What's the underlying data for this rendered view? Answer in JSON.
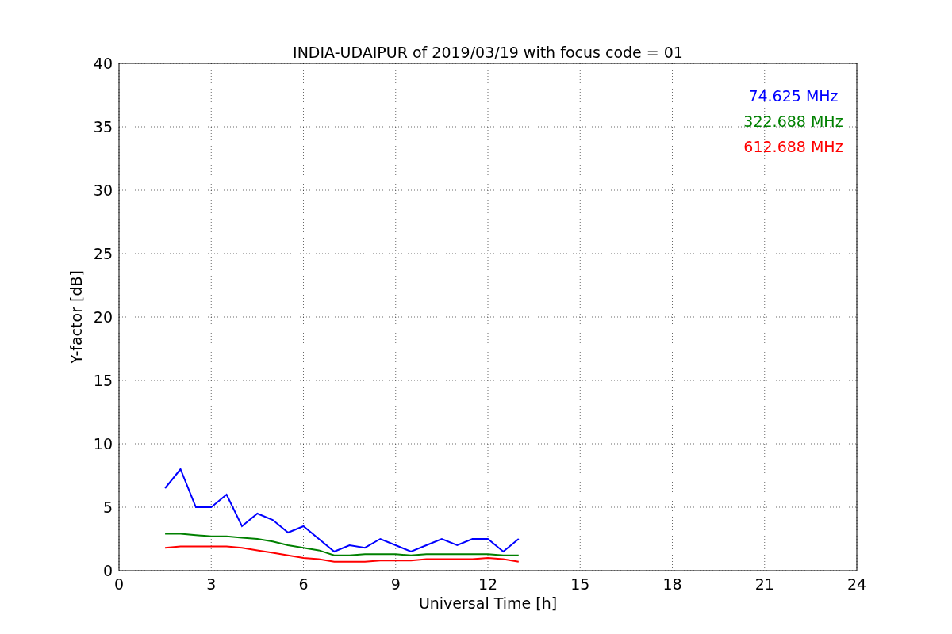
{
  "figure": {
    "chart_data": {
      "type": "line",
      "title": "INDIA-UDAIPUR of 2019/03/19 with focus code = 01",
      "xlabel": "Universal Time [h]",
      "ylabel": "Y-factor [dB]",
      "x": [
        1.5,
        2,
        2.5,
        3,
        3.5,
        4,
        4.5,
        5,
        5.5,
        6,
        6.5,
        7,
        7.5,
        8,
        8.5,
        9,
        9.5,
        10,
        10.5,
        11,
        11.5,
        12,
        12.5,
        13
      ],
      "series": [
        {
          "name": "74.625 MHz",
          "color": "#0000ff",
          "values": [
            6.5,
            8,
            5,
            5,
            6,
            3.5,
            4.5,
            4,
            3,
            3.5,
            2.5,
            1.5,
            2,
            1.8,
            2.5,
            2,
            1.5,
            2,
            2.5,
            2,
            2.5,
            2.5,
            1.5,
            2.5
          ]
        },
        {
          "name": "322.688 MHz",
          "color": "#008000",
          "values": [
            2.9,
            2.9,
            2.8,
            2.7,
            2.7,
            2.6,
            2.5,
            2.3,
            2.0,
            1.8,
            1.6,
            1.2,
            1.2,
            1.3,
            1.3,
            1.3,
            1.2,
            1.3,
            1.3,
            1.3,
            1.3,
            1.3,
            1.2,
            1.2
          ]
        },
        {
          "name": "612.688 MHz",
          "color": "#ff0000",
          "values": [
            1.8,
            1.9,
            1.9,
            1.9,
            1.9,
            1.8,
            1.6,
            1.4,
            1.2,
            1.0,
            0.9,
            0.7,
            0.7,
            0.7,
            0.8,
            0.8,
            0.8,
            0.9,
            0.9,
            0.9,
            0.9,
            1.0,
            0.9,
            0.7
          ]
        }
      ],
      "xlim": [
        0,
        24
      ],
      "ylim": [
        0,
        40
      ],
      "xticks": [
        0,
        3,
        6,
        9,
        12,
        15,
        18,
        21,
        24
      ],
      "yticks": [
        0,
        5,
        10,
        15,
        20,
        25,
        30,
        35,
        40
      ],
      "grid": true
    }
  }
}
